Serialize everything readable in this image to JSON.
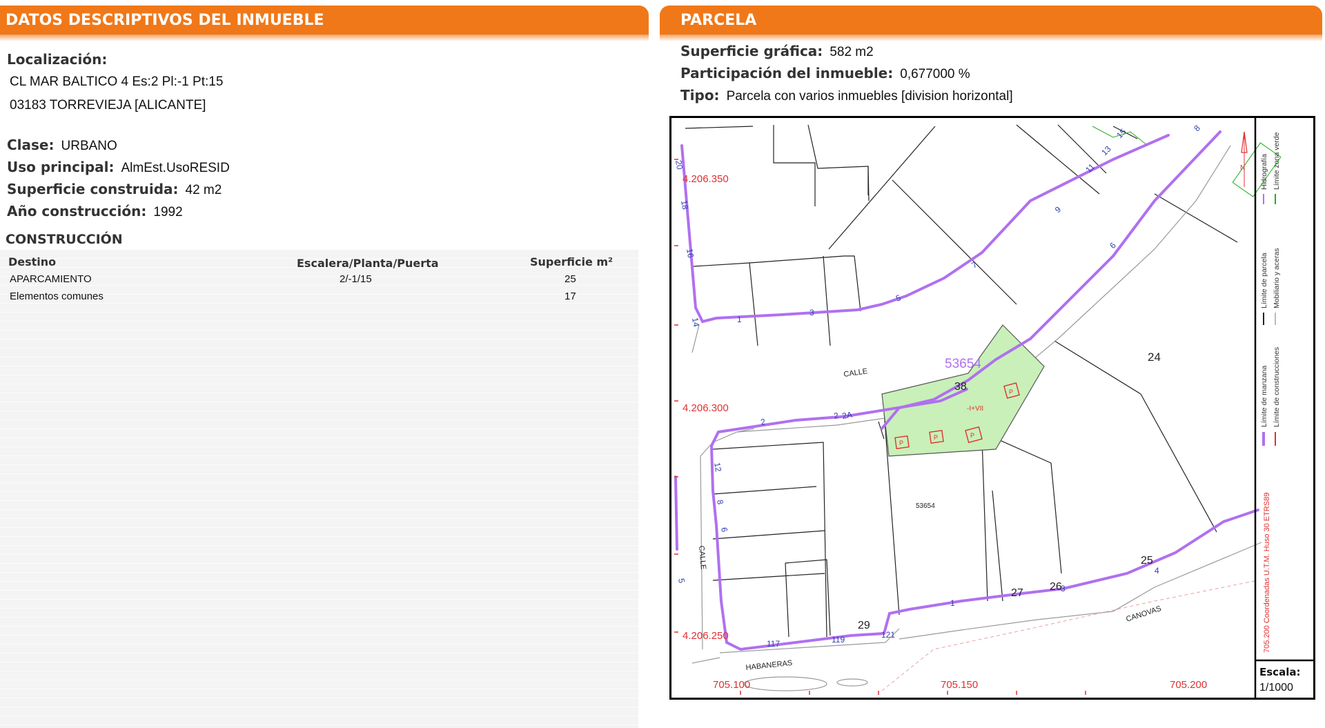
{
  "left": {
    "header": "DATOS DESCRIPTIVOS DEL INMUEBLE",
    "localizacion_label": "Localización:",
    "address_line1": "CL MAR BALTICO 4 Es:2 Pl:-1 Pt:15",
    "address_line2": "03183 TORREVIEJA [ALICANTE]",
    "clase_label": "Clase:",
    "clase_value": "URBANO",
    "uso_label": "Uso principal:",
    "uso_value": "AlmEst.UsoRESID",
    "superficie_label": "Superficie construida:",
    "superficie_value": "42 m2",
    "anio_label": "Año construcción:",
    "anio_value": "1992",
    "construccion_title": "CONSTRUCCIÓN",
    "table": {
      "headers": [
        "Destino",
        "Escalera/Planta/Puerta",
        "Superficie m²"
      ],
      "rows": [
        [
          "APARCAMIENTO",
          "2/-1/15",
          "25"
        ],
        [
          "Elementos comunes",
          "",
          "17"
        ]
      ]
    }
  },
  "right": {
    "header": "PARCELA",
    "sup_grafica_label": "Superficie gráfica:",
    "sup_grafica_value": "582 m2",
    "participacion_label": "Participación del inmueble:",
    "participacion_value": "0,677000 %",
    "tipo_label": "Tipo:",
    "tipo_value": "Parcela con varios inmuebles [division horizontal]"
  },
  "map": {
    "coord_y": [
      "4.206.350",
      "4.206.300",
      "4.206.250"
    ],
    "coord_x": [
      "705.100",
      "705.150",
      "705.200"
    ],
    "streets": [
      "CALLE",
      "CALLE",
      "HABANERAS",
      "CANOVAS"
    ],
    "parcel_ref_large": "53654",
    "parcel_ref_small": "53654",
    "parcel_numbers": [
      "24",
      "38",
      "25",
      "26",
      "27",
      "29"
    ],
    "parcel_floors": "-I+VII",
    "parking_symbol": "P",
    "edge_numbers": [
      "20",
      "18",
      "16",
      "14",
      "12",
      "8",
      "6",
      "5",
      "1",
      "3",
      "5",
      "7",
      "9",
      "11",
      "13",
      "15",
      "6",
      "8",
      "2",
      "2",
      "2A",
      "117",
      "119",
      "121",
      "1",
      "3",
      "4"
    ],
    "north": "N",
    "legend": {
      "limite_manzana": "Límite de manzana",
      "limite_construcciones": "Límite de construcciones",
      "limite_parcela": "Límite de parcela",
      "mobiliario": "Mobiliario y aceras",
      "hidrografia": "Hidrografía",
      "zona_verde": "Límite zona verde",
      "coordinates": "705.200 Coordenadas U.T.M. Huso 30 ETRS89"
    },
    "escala_label": "Escala:",
    "escala_value": "1/1000",
    "colors": {
      "purple": "#b070f0",
      "red": "#e03030",
      "green_fill": "#c8f0b8",
      "orange": "#f07818"
    }
  }
}
